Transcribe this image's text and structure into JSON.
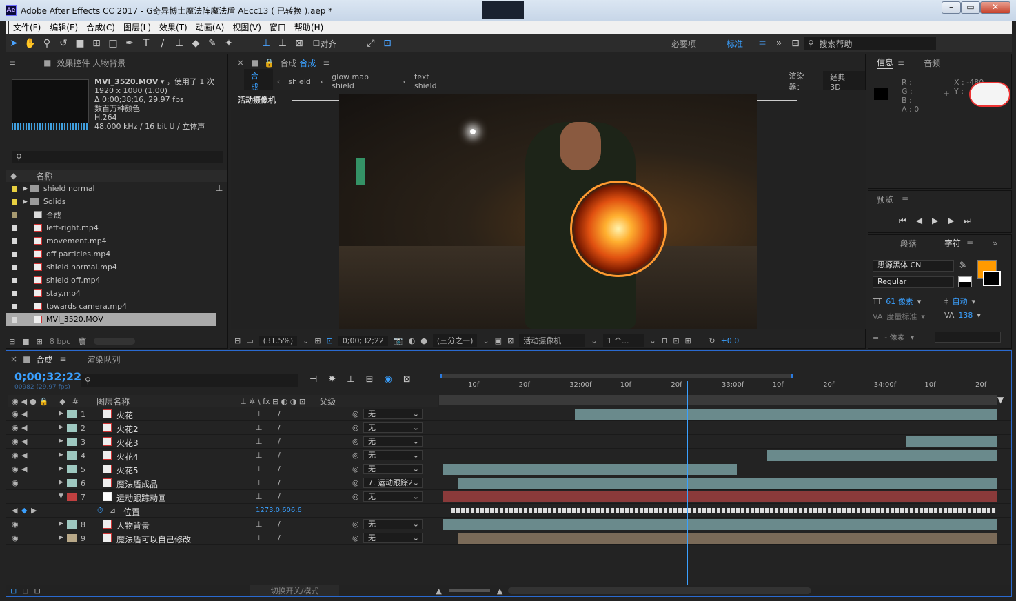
{
  "window": {
    "title": "Adobe After Effects CC 2017 - G奇异博士魔法阵魔法盾 AEcc13 ( 已转换 ).aep *",
    "app_icon": "Ae"
  },
  "menu": [
    "文件(F)",
    "编辑(E)",
    "合成(C)",
    "图层(L)",
    "效果(T)",
    "动画(A)",
    "视图(V)",
    "窗口",
    "帮助(H)"
  ],
  "toolbar": {
    "snap_label": "对齐",
    "workspace_essentials": "必要项",
    "workspace_standard": "标准",
    "search_placeholder": "搜索帮助"
  },
  "project": {
    "tab_label": "效果控件 人物背景",
    "footage": {
      "name": "MVI_3520.MOV",
      "used": "，使用了 1 次",
      "res": "1920 x 1080 (1.00)",
      "dur": "Δ 0;00;38;16, 29.97 fps",
      "colors": "数百万种颜色",
      "codec": "H.264",
      "audio": "48.000 kHz / 16 bit U / 立体声"
    },
    "col_name": "名称",
    "items": [
      {
        "name": "shield normal",
        "type": "folder",
        "color": "#e8d040"
      },
      {
        "name": "Solids",
        "type": "folder",
        "color": "#e8d040"
      },
      {
        "name": "合成",
        "type": "comp",
        "color": "#a89a70"
      },
      {
        "name": "left-right.mp4",
        "type": "file",
        "color": "#d8d8d8"
      },
      {
        "name": "movement.mp4",
        "type": "file",
        "color": "#d8d8d8"
      },
      {
        "name": "off particles.mp4",
        "type": "file",
        "color": "#d8d8d8"
      },
      {
        "name": "shield normal.mp4",
        "type": "file",
        "color": "#d8d8d8"
      },
      {
        "name": "shield off.mp4",
        "type": "file",
        "color": "#d8d8d8"
      },
      {
        "name": "stay.mp4",
        "type": "file",
        "color": "#d8d8d8"
      },
      {
        "name": "towards camera.mp4",
        "type": "file",
        "color": "#d8d8d8"
      },
      {
        "name": "MVI_3520.MOV",
        "type": "file",
        "color": "#d8d8d8",
        "selected": true
      }
    ],
    "bpc": "8 bpc"
  },
  "comp": {
    "tab_label": "合成",
    "tab_name": "合成",
    "breadcrumbs": [
      "合成",
      "shield",
      "glow map shield",
      "text shield"
    ],
    "renderer_label": "渲染器：",
    "renderer": "经典 3D",
    "camera_label": "活动摄像机",
    "footer": {
      "zoom": "(31.5%)",
      "time": "0;00;32;22",
      "res": "(三分之一)",
      "camera": "活动摄像机",
      "views": "1 个...",
      "exposure": "+0.0"
    }
  },
  "info": {
    "tab_info": "信息",
    "tab_audio": "音频",
    "r": "R :",
    "g": "G :",
    "b": "B :",
    "a": "A : 0",
    "x": "X : -480",
    "y": "Y :"
  },
  "preview": {
    "label": "预览"
  },
  "character": {
    "tab_para": "段落",
    "tab_char": "字符",
    "font": "思源黑体 CN",
    "style": "Regular",
    "size": "61 像素",
    "leading": "自动",
    "kerning": "度量标准",
    "tracking": "138",
    "units": "- 像素",
    "fill": "#ff9a00"
  },
  "timeline": {
    "tab": "合成",
    "render_queue": "渲染队列",
    "timecode": "0;00;32;22",
    "frames": "00982 (29.97 fps)",
    "col_num": "#",
    "col_name": "图层名称",
    "col_parent": "父级",
    "ruler": [
      "10f",
      "20f",
      "32:00f",
      "10f",
      "20f",
      "33:00f",
      "10f",
      "20f",
      "34:00f",
      "10f",
      "20f"
    ],
    "layers": [
      {
        "num": "1",
        "name": "火花",
        "parent": "无",
        "color": "#9ec8c0",
        "bar_start": 0.238,
        "bar_end": 1.0
      },
      {
        "num": "2",
        "name": "火花2",
        "parent": "无",
        "color": "#9ec8c0",
        "bar_start": 1.0,
        "bar_end": 1.0
      },
      {
        "num": "3",
        "name": "火花3",
        "parent": "无",
        "color": "#9ec8c0",
        "bar_start": 0.835,
        "bar_end": 1.0
      },
      {
        "num": "4",
        "name": "火花4",
        "parent": "无",
        "color": "#9ec8c0",
        "bar_start": 0.585,
        "bar_end": 1.0
      },
      {
        "num": "5",
        "name": "火花5",
        "parent": "无",
        "color": "#9ec8c0",
        "bar_start": 0.0,
        "bar_end": 0.53
      },
      {
        "num": "6",
        "name": "魔法盾成品",
        "parent": "7. 运动跟踪2",
        "color": "#9ec8c0",
        "bar_start": 0.027,
        "bar_end": 1.0
      },
      {
        "num": "7",
        "name": "运动跟踪动画",
        "parent": "无",
        "color": "#c04040",
        "bar_start": 0.0,
        "bar_end": 1.0
      },
      {
        "num": "8",
        "name": "人物背景",
        "parent": "无",
        "color": "#9ec8c0",
        "bar_start": 0.0,
        "bar_end": 1.0
      },
      {
        "num": "9",
        "name": "魔法盾可以自己修改",
        "parent": "无",
        "color": "#b8a888",
        "bar_start": 0.027,
        "bar_end": 1.0
      }
    ],
    "property": {
      "name": "位置",
      "value": "1273.0,606.6"
    },
    "playhead": 0.44,
    "footer_label": "切换开关/模式"
  }
}
